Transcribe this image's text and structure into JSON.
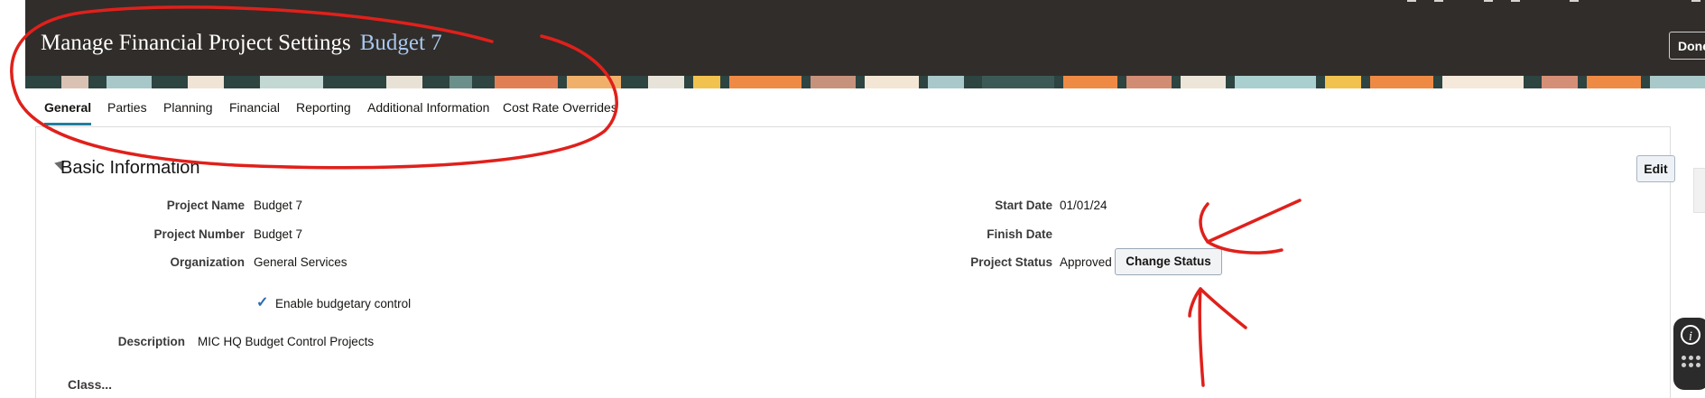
{
  "header": {
    "title": "Manage Financial Project Settings",
    "subtitle": "Budget 7",
    "done_label": "Done"
  },
  "tabs": [
    {
      "label": "General",
      "active": true
    },
    {
      "label": "Parties"
    },
    {
      "label": "Planning"
    },
    {
      "label": "Financial"
    },
    {
      "label": "Reporting"
    },
    {
      "label": "Additional Information"
    },
    {
      "label": "Cost Rate Overrides"
    }
  ],
  "basic_info": {
    "title": "Basic Information",
    "edit_label": "Edit",
    "project_name_label": "Project Name",
    "project_name": "Budget 7",
    "project_number_label": "Project Number",
    "project_number": "Budget 7",
    "organization_label": "Organization",
    "organization": "General Services",
    "budgetary_control_label": "Enable budgetary control",
    "budgetary_control_checked": true,
    "description_label": "Description",
    "description": "MIC HQ Budget Control Projects",
    "start_date_label": "Start Date",
    "start_date": "01/01/24",
    "finish_date_label": "Finish Date",
    "finish_date": "",
    "project_status_label": "Project Status",
    "project_status": "Approved",
    "change_status_label": "Change Status"
  },
  "next_section_partial": "Class...",
  "colors": {
    "header_bg": "#312d2a",
    "subtitle": "#a7c8ef",
    "active_tab_underline": "#227e9e",
    "annotation_red": "#e0201b"
  }
}
